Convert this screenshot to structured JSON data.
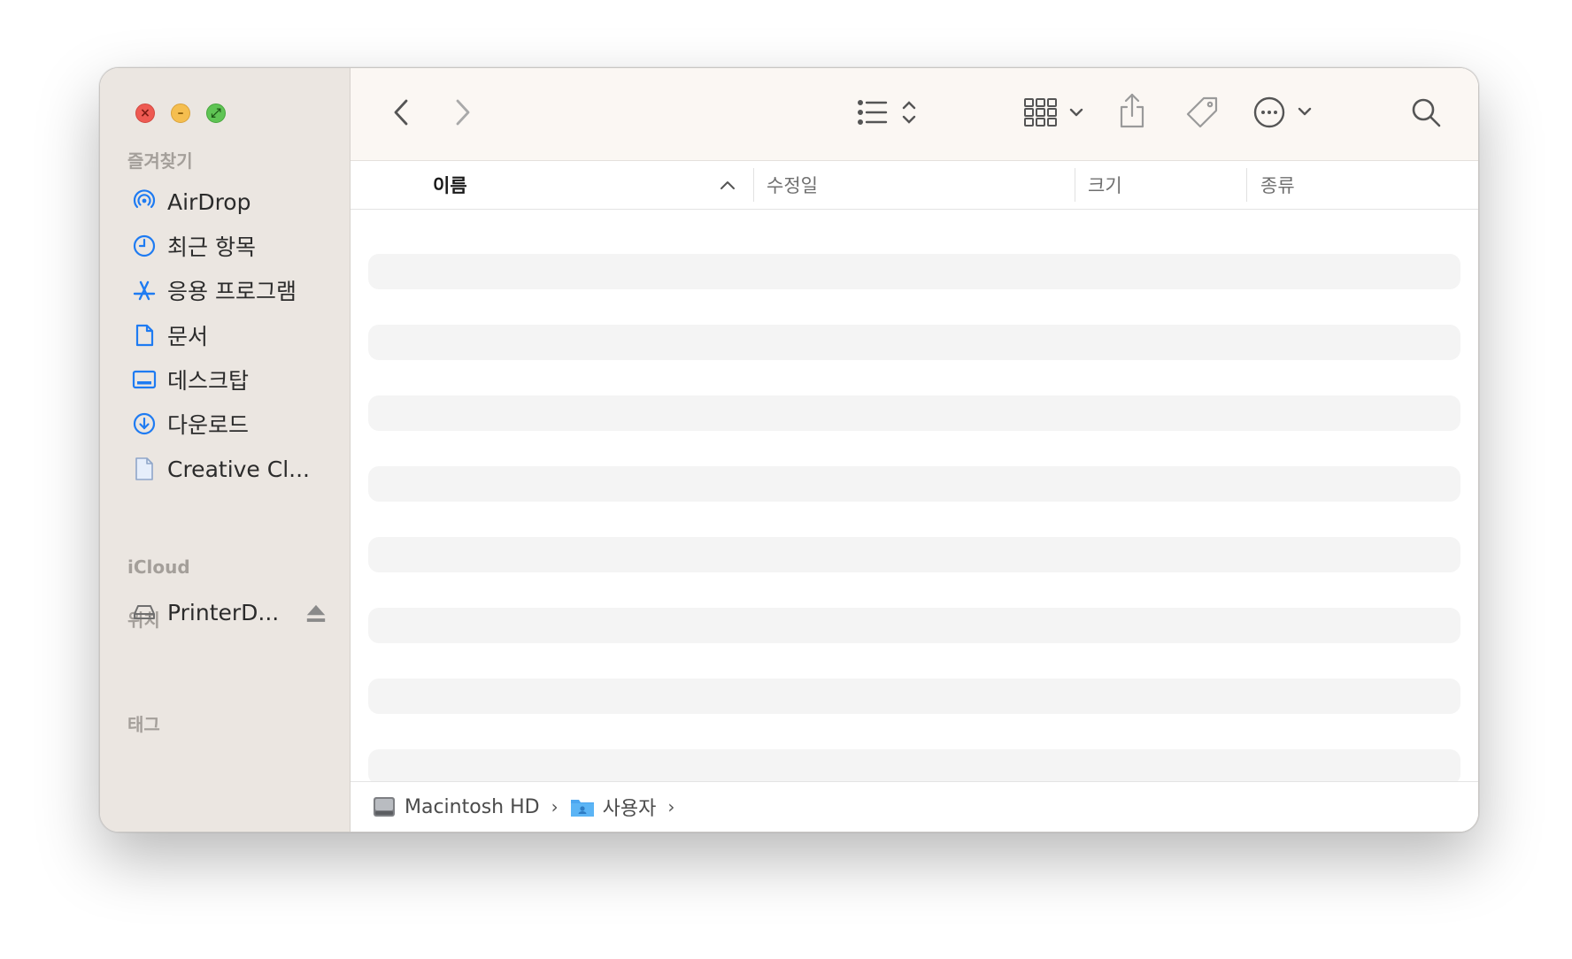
{
  "sidebar": {
    "favorites_header": "즐겨찾기",
    "favorites": [
      {
        "label": "AirDrop",
        "icon": "airdrop-icon"
      },
      {
        "label": "최근 항목",
        "icon": "clock-icon"
      },
      {
        "label": "응용 프로그램",
        "icon": "applications-icon"
      },
      {
        "label": "문서",
        "icon": "document-icon"
      },
      {
        "label": "데스크탑",
        "icon": "desktop-icon"
      },
      {
        "label": "다운로드",
        "icon": "download-icon"
      },
      {
        "label": "Creative Cl...",
        "icon": "file-icon"
      }
    ],
    "icloud_header": "iCloud",
    "locations_header": "위치",
    "locations": [
      {
        "label": "PrinterD...",
        "icon": "drive-icon"
      }
    ],
    "tags_header": "태그"
  },
  "columns": {
    "name": "이름",
    "modified": "수정일",
    "size": "크기",
    "kind": "종류"
  },
  "pathbar": {
    "items": [
      {
        "label": "Macintosh HD",
        "icon": "hard-drive-icon"
      },
      {
        "label": "사용자",
        "icon": "users-folder-icon"
      }
    ]
  },
  "colors": {
    "accent": "#1e7bf2",
    "sidebar_bg": "#ebe6e1",
    "toolbar_bg": "#fbf7f3",
    "row_placeholder": "#f4f4f4"
  }
}
